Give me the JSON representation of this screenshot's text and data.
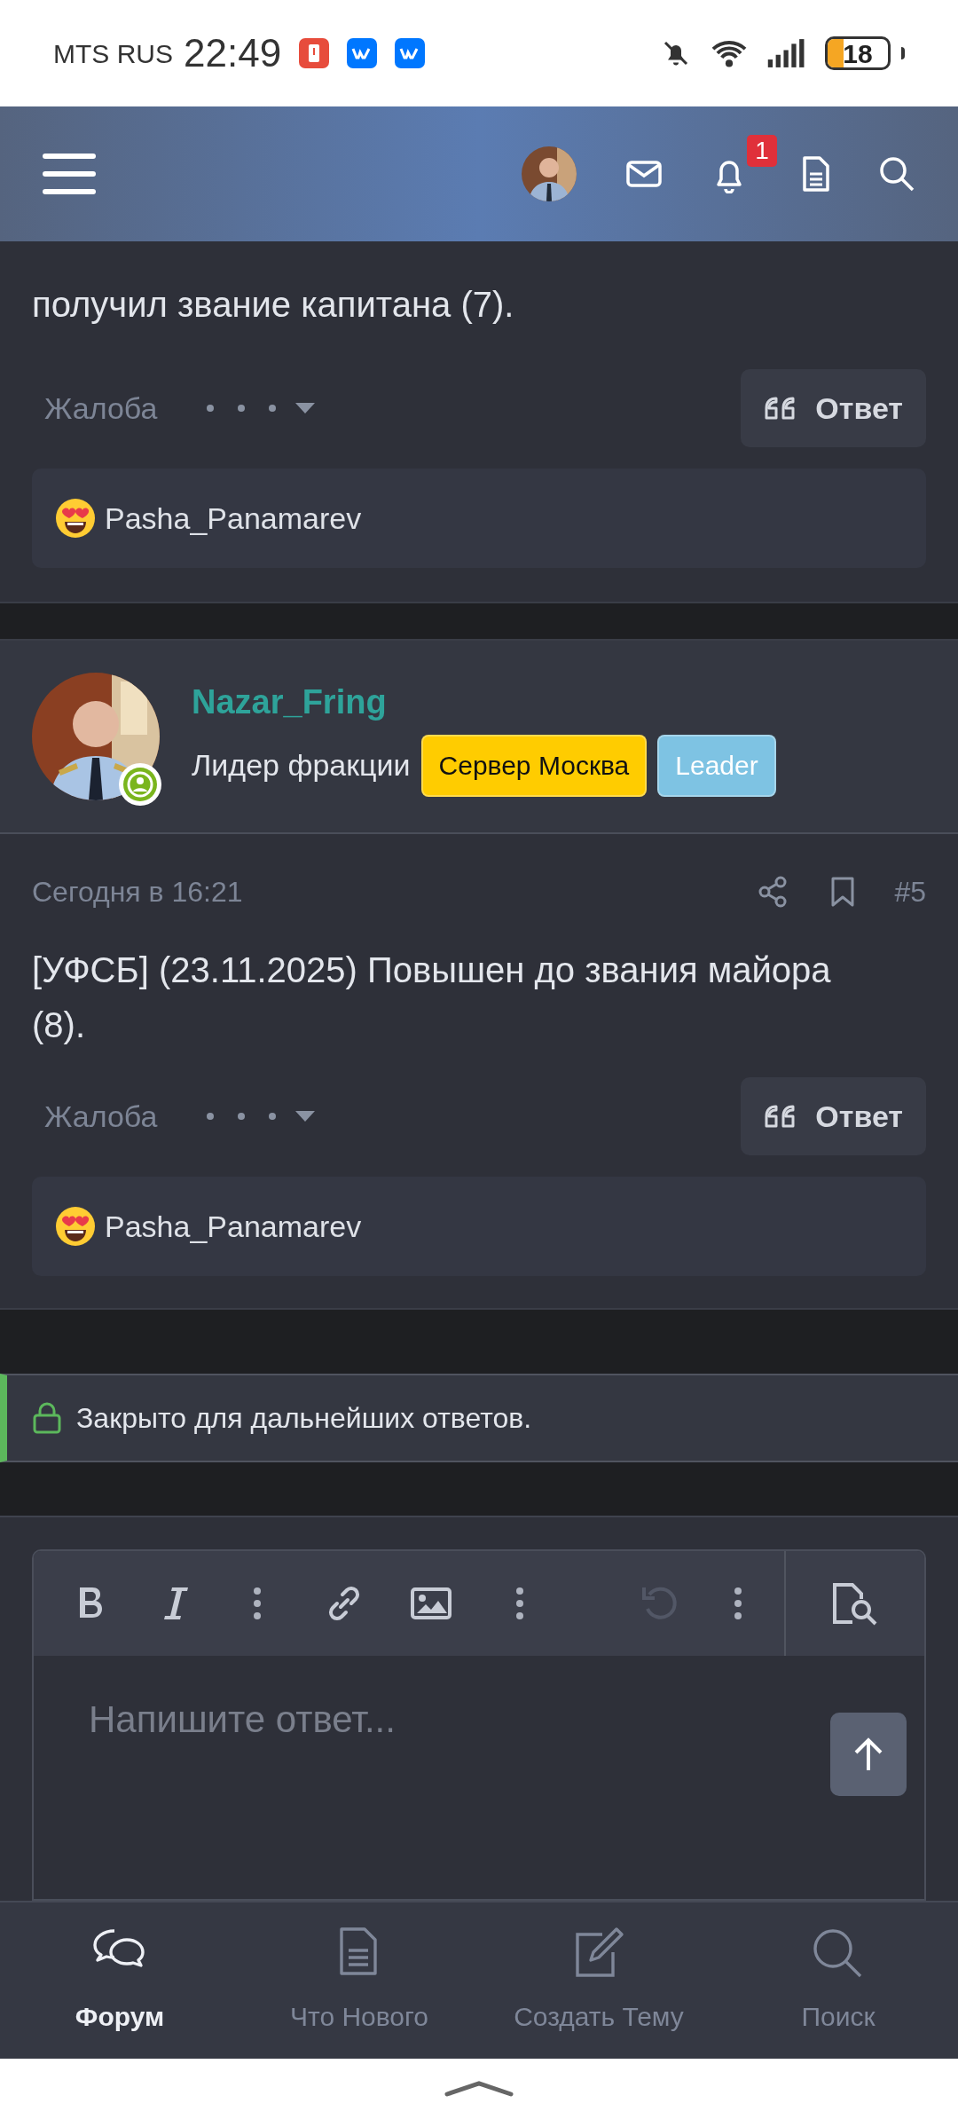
{
  "status_bar": {
    "carrier": "MTS RUS",
    "time": "22:49",
    "battery": "18"
  },
  "header": {
    "notification_count": "1"
  },
  "posts": [
    {
      "kind": "tail",
      "body": "получил звание капитана (7).",
      "report": "Жалоба",
      "reply": "Ответ",
      "reaction_user": "Pasha_Panamarev"
    },
    {
      "kind": "full",
      "author": "Nazar_Fring",
      "user_title": "Лидер фракции",
      "banners": [
        {
          "label": "Сервер Москва",
          "color": "#ffcc00"
        },
        {
          "label": "Leader",
          "color": "#7ec3e3"
        }
      ],
      "date": "Сегодня в 16:21",
      "number": "#5",
      "body": "[УФСБ] (23.11.2025) Повышен до звания майора (8).",
      "report": "Жалоба",
      "reply": "Ответ",
      "reaction_user": "Pasha_Panamarev"
    }
  ],
  "locked_notice": "Закрыто для дальнейших ответов.",
  "editor": {
    "placeholder": "Напишите ответ..."
  },
  "bottom_nav": [
    {
      "label": "Форум",
      "selected": true
    },
    {
      "label": "Что Нового",
      "selected": false
    },
    {
      "label": "Создать Тему",
      "selected": false
    },
    {
      "label": "Поиск",
      "selected": false
    }
  ]
}
